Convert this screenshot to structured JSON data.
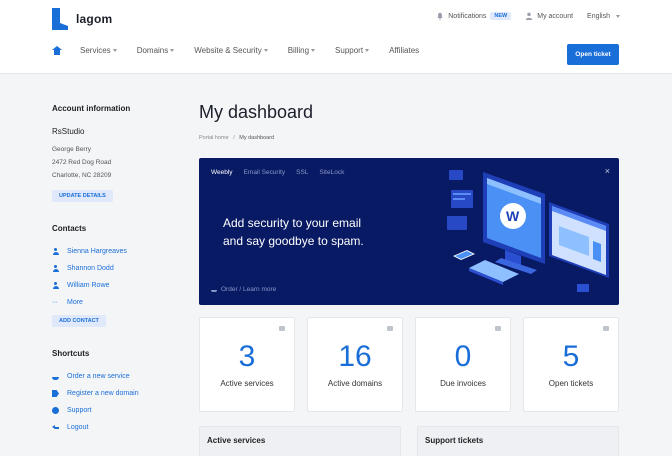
{
  "brand": {
    "name": "lagom",
    "color": "#1a6ed8"
  },
  "topbar": {
    "notifications_label": "Notifications",
    "notifications_badge": "NEW",
    "account_label": "My account",
    "language_label": "English"
  },
  "nav": {
    "items": [
      {
        "label": "Services",
        "dropdown": true
      },
      {
        "label": "Domains",
        "dropdown": true
      },
      {
        "label": "Website & Security",
        "dropdown": true
      },
      {
        "label": "Billing",
        "dropdown": true
      },
      {
        "label": "Support",
        "dropdown": true
      },
      {
        "label": "Affiliates",
        "dropdown": false
      }
    ],
    "open_ticket_label": "Open ticket"
  },
  "sidebar": {
    "account_title": "Account information",
    "company": "RsStudio",
    "address": [
      "George Berry",
      "2472 Red Dog Road",
      "Charlotte, NC 28209"
    ],
    "update_label": "UPDATE DETAILS",
    "contacts_title": "Contacts",
    "contacts": [
      "Sienna Hargreaves",
      "Shannon Dodd",
      "William Rowe"
    ],
    "more_label": "More",
    "add_contact_label": "ADD CONTACT",
    "shortcuts_title": "Shortcuts",
    "shortcuts": [
      "Order a new service",
      "Register a new domain",
      "Support",
      "Logout"
    ]
  },
  "main": {
    "title": "My dashboard",
    "breadcrumb": {
      "home": "Portal home",
      "separator": "/",
      "current": "My dashboard"
    }
  },
  "banner": {
    "background": "#081a63",
    "tabs": [
      "Weebly",
      "Email Security",
      "SSL",
      "SiteLock"
    ],
    "active_tab": "Weebly",
    "close_label": "×",
    "headline_line1": "Add security to your email",
    "headline_line2": "and say goodbye to spam.",
    "footer_label": "Order / Learn more"
  },
  "stats": [
    {
      "value": "3",
      "label": "Active services",
      "icon": "server-icon"
    },
    {
      "value": "16",
      "label": "Active domains",
      "icon": "tag-icon"
    },
    {
      "value": "0",
      "label": "Due invoices",
      "icon": "document-icon"
    },
    {
      "value": "5",
      "label": "Open tickets",
      "icon": "ticket-icon"
    }
  ],
  "panels": {
    "active_services_title": "Active services",
    "support_tickets_title": "Support tickets"
  }
}
